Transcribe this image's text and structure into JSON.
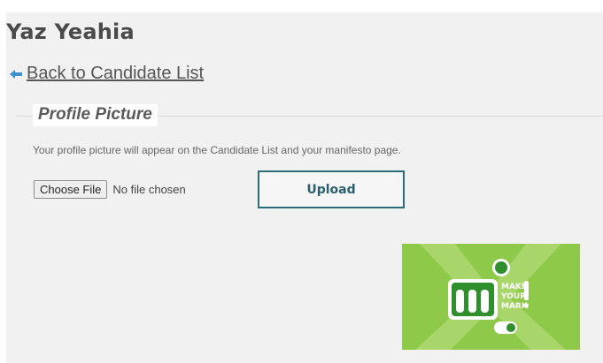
{
  "candidate": {
    "name": "Yaz Yeahia"
  },
  "nav": {
    "back_label": "Back to Candidate List"
  },
  "profile": {
    "section_title": "Profile Picture",
    "help_text": "Your profile picture will appear on the Candidate List and your manifesto page.",
    "choose_file_label": "Choose File",
    "file_status": "No file chosen",
    "upload_label": "Upload"
  },
  "image": {
    "logo_line1": "MAKE",
    "logo_line2": "YOUR",
    "logo_line3": "MARK",
    "colors": {
      "background": "#8fc94a",
      "accent": "#a8d66a",
      "mark": "#2e8f2c",
      "text": "#ffffff"
    }
  },
  "theme": {
    "upload_border": "#2c6e78",
    "panel_background": "#f1f1f1"
  }
}
